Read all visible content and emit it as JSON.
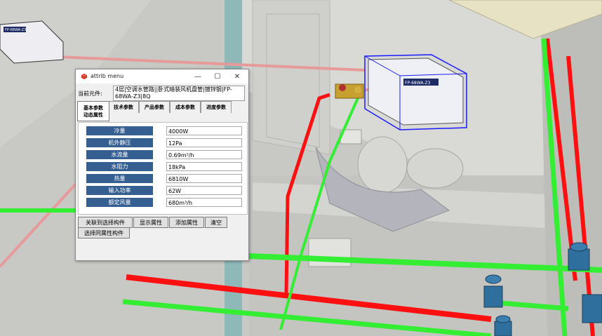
{
  "window": {
    "title": "attrib menu",
    "minimize_glyph": "—",
    "maximize_glyph": "☐",
    "close_glyph": "✕"
  },
  "current_element": {
    "label": "当前元件:",
    "value": "4层|空调水管路||卧式暗装风机盘管|镀锌钢|FP-68WA-Z3|8Q"
  },
  "tabs": [
    {
      "label": "基本参数"
    },
    {
      "label": "动态属性"
    },
    {
      "label": "技术参数"
    },
    {
      "label": "产品参数"
    },
    {
      "label": "成本参数"
    },
    {
      "label": "进度参数"
    }
  ],
  "properties": [
    {
      "label": "冷量",
      "value": "4000W"
    },
    {
      "label": "机外静压",
      "value": "12Pa"
    },
    {
      "label": "水流量",
      "value": "0.69m³/h"
    },
    {
      "label": "水阻力",
      "value": "18kPa"
    },
    {
      "label": "热量",
      "value": "6810W"
    },
    {
      "label": "输入功率",
      "value": "62W"
    },
    {
      "label": "额定风量",
      "value": "680m³/h"
    }
  ],
  "actions": {
    "link_selected": "关联到选择构件",
    "show_props": "显示属性",
    "add_props": "添加属性",
    "clear": "清空",
    "select_same": "选择同属性构件"
  },
  "scene_labels": {
    "fcu_nameplate_left": "FP-68WA-Z3",
    "fcu_nameplate_right": "FP-68WA-Z3"
  },
  "colors": {
    "supply_pipe": "#ff0000",
    "return_pipe": "#33ee33",
    "condensate_pipe": "#e79a9a",
    "selection": "#1a1aff",
    "valve": "#2e6f9e",
    "label_bg": "#355f91"
  }
}
